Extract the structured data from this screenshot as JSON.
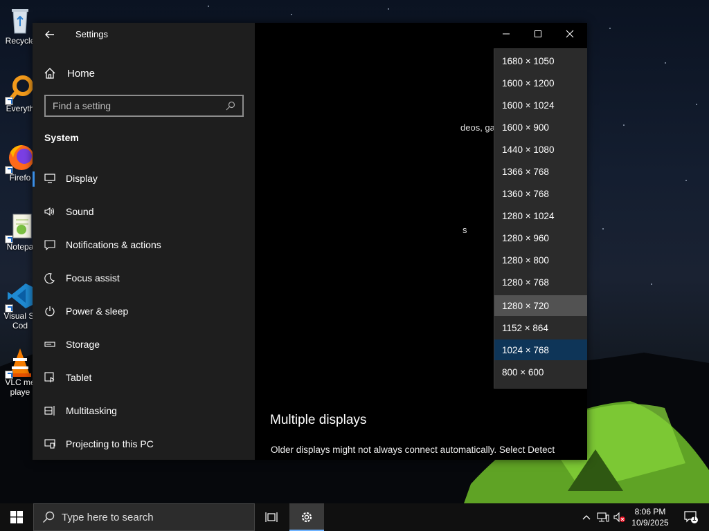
{
  "desktop": {
    "icons": [
      {
        "label": "Recycle",
        "icon": "recycle-bin-icon"
      },
      {
        "label": "Everyth",
        "icon": "everything-search-icon"
      },
      {
        "label": "Firefo",
        "icon": "firefox-icon"
      },
      {
        "label": "Notepa",
        "icon": "notepad-plus-plus-icon"
      },
      {
        "label": "Visual St\nCod",
        "icon": "vscode-icon"
      },
      {
        "label": "VLC me\nplaye",
        "icon": "vlc-icon"
      }
    ]
  },
  "window": {
    "title": "Settings",
    "controls": {
      "minimize": "minimize-icon",
      "maximize": "maximize-icon",
      "close": "close-icon"
    }
  },
  "nav": {
    "home_label": "Home",
    "search_placeholder": "Find a setting",
    "section_heading": "System",
    "items": [
      {
        "label": "Display",
        "icon": "monitor-icon"
      },
      {
        "label": "Sound",
        "icon": "speaker-icon"
      },
      {
        "label": "Notifications & actions",
        "icon": "notification-icon"
      },
      {
        "label": "Focus assist",
        "icon": "moon-icon"
      },
      {
        "label": "Power & sleep",
        "icon": "power-icon"
      },
      {
        "label": "Storage",
        "icon": "storage-icon"
      },
      {
        "label": "Tablet",
        "icon": "tablet-icon"
      },
      {
        "label": "Multitasking",
        "icon": "multitasking-icon"
      },
      {
        "label": "Projecting to this PC",
        "icon": "projecting-icon"
      }
    ],
    "active_item": "Display"
  },
  "content": {
    "partial_text_1": "deos, games and apps",
    "partial_text_2": "s",
    "multiple_displays_heading": "Multiple displays",
    "multiple_displays_desc": "Older displays might not always connect automatically. Select Detect"
  },
  "resolution_dropdown": {
    "options": [
      "1680 × 1050",
      "1600 × 1200",
      "1600 × 1024",
      "1600 × 900",
      "1440 × 1080",
      "1366 × 768",
      "1360 × 768",
      "1280 × 1024",
      "1280 × 960",
      "1280 × 800",
      "1280 × 768",
      "1280 × 720",
      "1152 × 864",
      "1024 × 768",
      "800 × 600"
    ],
    "hovered": "1280 × 720",
    "selected": "1024 × 768"
  },
  "taskbar": {
    "search_placeholder": "Type here to search",
    "clock_time": "8:06 PM",
    "clock_date": "10/9/2025",
    "notification_count": "1"
  },
  "colors": {
    "accent": "#3a8ee6",
    "selected_option": "#0e3558",
    "hover_option": "#525252"
  }
}
